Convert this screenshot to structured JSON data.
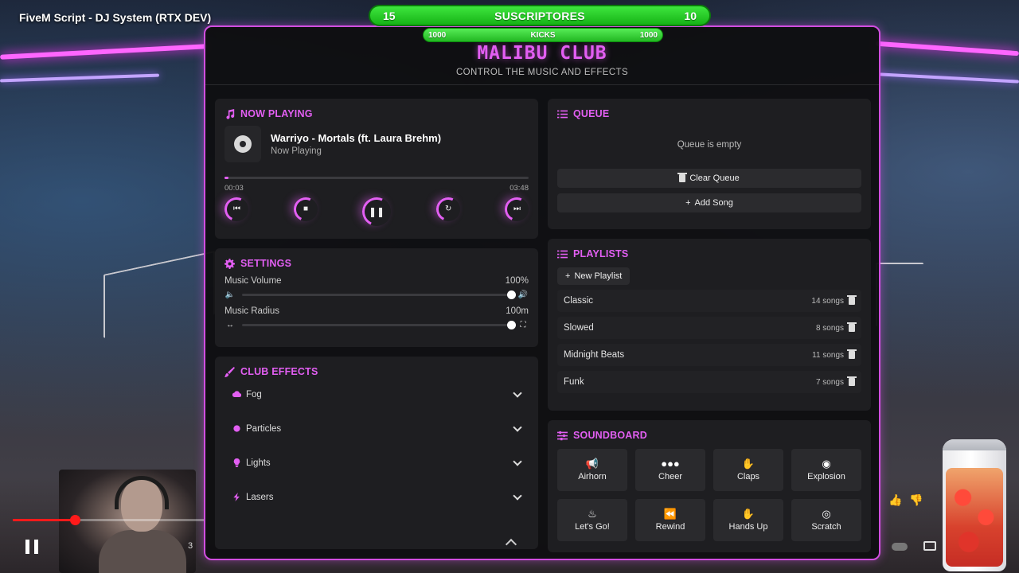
{
  "video": {
    "title": "FiveM Script - DJ System (RTX DEV)",
    "side_number": "3"
  },
  "subscribers_bar": {
    "left": "15",
    "label": "SUSCRIPTORES",
    "right": "10"
  },
  "kicks_bar": {
    "left": "1000",
    "label": "KICKS",
    "right": "1000"
  },
  "header": {
    "title": "MALIBU CLUB",
    "subtitle": "CONTROL THE MUSIC AND EFFECTS"
  },
  "now_playing": {
    "heading": "NOW PLAYING",
    "track_title": "Warriyo - Mortals (ft. Laura Brehm)",
    "status": "Now Playing",
    "elapsed": "00:03",
    "duration": "03:48",
    "progress_fraction": 0.013
  },
  "settings": {
    "heading": "SETTINGS",
    "volume_label": "Music Volume",
    "volume_value": "100%",
    "volume_fraction": 1.0,
    "radius_label": "Music Radius",
    "radius_value": "100m",
    "radius_fraction": 1.0
  },
  "club_effects": {
    "heading": "CLUB EFFECTS",
    "items": [
      {
        "label": "Fog"
      },
      {
        "label": "Particles"
      },
      {
        "label": "Lights"
      },
      {
        "label": "Lasers"
      }
    ]
  },
  "queue": {
    "heading": "QUEUE",
    "empty_text": "Queue is empty",
    "clear_label": "Clear Queue",
    "add_label": "Add Song"
  },
  "playlists": {
    "heading": "PLAYLISTS",
    "new_label": "New Playlist",
    "items": [
      {
        "name": "Classic",
        "count": "14 songs"
      },
      {
        "name": "Slowed",
        "count": "8 songs"
      },
      {
        "name": "Midnight Beats",
        "count": "11 songs"
      },
      {
        "name": "Funk",
        "count": "7 songs"
      }
    ]
  },
  "soundboard": {
    "heading": "SOUNDBOARD",
    "buttons": [
      {
        "label": "Airhorn",
        "icon": "megaphone-icon"
      },
      {
        "label": "Cheer",
        "icon": "users-icon"
      },
      {
        "label": "Claps",
        "icon": "hands-clapping-icon"
      },
      {
        "label": "Explosion",
        "icon": "bomb-icon"
      },
      {
        "label": "Let's Go!",
        "icon": "fire-icon"
      },
      {
        "label": "Rewind",
        "icon": "backward-icon"
      },
      {
        "label": "Hands Up",
        "icon": "hand-icon"
      },
      {
        "label": "Scratch",
        "icon": "record-icon"
      }
    ]
  },
  "colors": {
    "accent": "#e35ff3",
    "panel_border": "#d14ee0",
    "green_bar": "#22b722"
  }
}
